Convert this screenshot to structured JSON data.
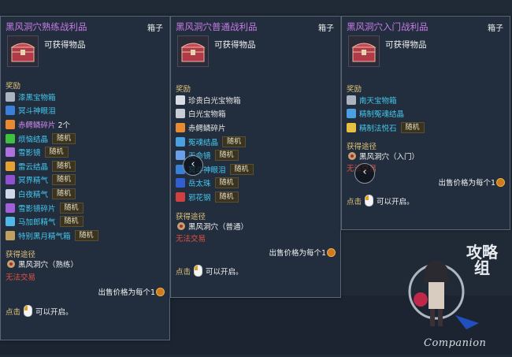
{
  "panels": [
    {
      "title": "黑风洞穴熟练战利品",
      "type": "箱子",
      "obtain": "可获得物品",
      "rewards_label": "奖励",
      "rewards": [
        {
          "name": "漆黑宝物箱",
          "icon": "chest-icon",
          "color": "cyan",
          "count": "",
          "tag": ""
        },
        {
          "name": "冥斗神眼泪",
          "icon": "tear-icon",
          "color": "cyan",
          "count": "",
          "tag": ""
        },
        {
          "name": "赤鳄鳞碎片",
          "icon": "scale-icon",
          "color": "purple",
          "count": "2个",
          "tag": ""
        },
        {
          "name": "烦恼结晶",
          "icon": "green-crystal-icon",
          "color": "cyan",
          "count": "",
          "tag": "随机"
        },
        {
          "name": "雪影镜",
          "icon": "mirror-icon",
          "color": "cyan",
          "count": "",
          "tag": "随机"
        },
        {
          "name": "雷云结晶",
          "icon": "cloud-crystal-icon",
          "color": "cyan",
          "count": "",
          "tag": "随机"
        },
        {
          "name": "冥界精气",
          "icon": "spirit-icon",
          "color": "cyan",
          "count": "",
          "tag": "随机"
        },
        {
          "name": "白夜精气",
          "icon": "white-spirit-icon",
          "color": "cyan",
          "count": "",
          "tag": "随机"
        },
        {
          "name": "雪影镜碎片",
          "icon": "mirror-shard-icon",
          "color": "cyan",
          "count": "",
          "tag": "随机"
        },
        {
          "name": "马加郎精气",
          "icon": "magalang-spirit-icon",
          "color": "cyan",
          "count": "",
          "tag": "随机"
        },
        {
          "name": "特别黑月精气箱",
          "icon": "box-icon",
          "color": "cyan",
          "count": "",
          "tag": "随机"
        }
      ],
      "source_label": "获得途径",
      "source": "黑风洞穴（熟练）",
      "untradeable": "无法交易",
      "price": "出售价格为每个1",
      "click": "点击",
      "open": "可以开启。"
    },
    {
      "title": "黑风洞穴普通战利品",
      "type": "箱子",
      "obtain": "可获得物品",
      "rewards_label": "奖励",
      "rewards": [
        {
          "name": "珍贵白光宝物箱",
          "icon": "chest-icon",
          "color": "white",
          "count": "",
          "tag": ""
        },
        {
          "name": "白光宝物箱",
          "icon": "chest-icon",
          "color": "white",
          "count": "",
          "tag": ""
        },
        {
          "name": "赤鳄鳞碎片",
          "icon": "scale-icon",
          "color": "white",
          "count": "",
          "tag": ""
        },
        {
          "name": "冤魂结晶",
          "icon": "soul-crystal-icon",
          "color": "cyan",
          "count": "",
          "tag": "随机"
        },
        {
          "name": "天命镜",
          "icon": "mirror-icon",
          "color": "cyan",
          "count": "",
          "tag": "随机"
        },
        {
          "name": "冥斗神眼泪",
          "icon": "tear-icon",
          "color": "cyan",
          "count": "",
          "tag": "随机"
        },
        {
          "name": "岳太珠",
          "icon": "pearl-icon",
          "color": "cyan",
          "count": "",
          "tag": "随机"
        },
        {
          "name": "邪花钢",
          "icon": "steel-icon",
          "color": "cyan",
          "count": "",
          "tag": "随机"
        }
      ],
      "source_label": "获得途径",
      "source": "黑风洞穴（普通）",
      "untradeable": "无法交易",
      "price": "出售价格为每个1",
      "click": "点击",
      "open": "可以开启。"
    },
    {
      "title": "黑风洞穴入门战利品",
      "type": "箱子",
      "obtain": "可获得物品",
      "rewards_label": "奖励",
      "rewards": [
        {
          "name": "南天宝物箱",
          "icon": "chest-icon",
          "color": "cyan",
          "count": "",
          "tag": ""
        },
        {
          "name": "精制冤魂结晶",
          "icon": "soul-crystal-icon",
          "color": "cyan",
          "count": "",
          "tag": ""
        },
        {
          "name": "精制法悦石",
          "icon": "stone-icon",
          "color": "cyan",
          "count": "",
          "tag": "随机"
        }
      ],
      "source_label": "获得途径",
      "source": "黑风洞穴（入门）",
      "untradeable": "无法交易",
      "price": "出售价格为每个1",
      "click": "点击",
      "open": "可以开启。"
    }
  ],
  "carousel_prev": "‹",
  "companion": {
    "text": "Companion",
    "chinese": "攻略组"
  },
  "colors": {
    "title": "#c97ae8",
    "item": "#45c6ee",
    "section": "#e0c27a",
    "warning": "#e05040"
  }
}
